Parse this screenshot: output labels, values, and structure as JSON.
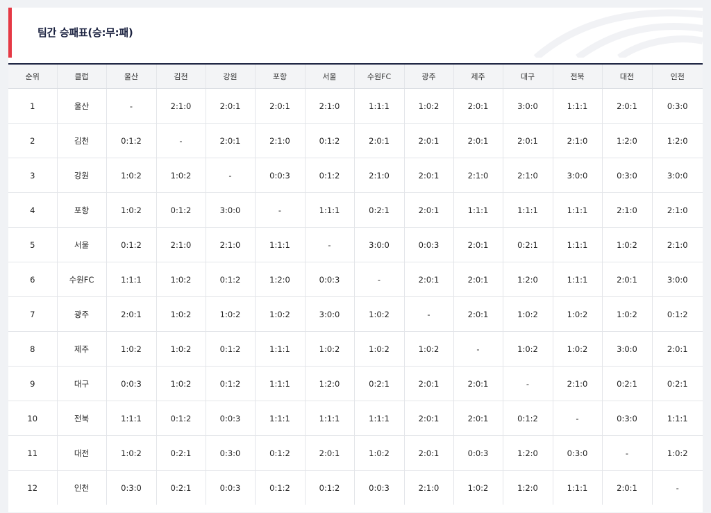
{
  "header": {
    "title": "팀간 승패표(승:무:패)"
  },
  "colors": {
    "accent": "#e53945",
    "navy": "#1b2240"
  },
  "table": {
    "columns": [
      "순위",
      "클럽",
      "울산",
      "김천",
      "강원",
      "포항",
      "서울",
      "수원FC",
      "광주",
      "제주",
      "대구",
      "전북",
      "대전",
      "인천"
    ],
    "rows": [
      [
        "1",
        "울산",
        "-",
        "2:1:0",
        "2:0:1",
        "2:0:1",
        "2:1:0",
        "1:1:1",
        "1:0:2",
        "2:0:1",
        "3:0:0",
        "1:1:1",
        "2:0:1",
        "0:3:0"
      ],
      [
        "2",
        "김천",
        "0:1:2",
        "-",
        "2:0:1",
        "2:1:0",
        "0:1:2",
        "2:0:1",
        "2:0:1",
        "2:0:1",
        "2:0:1",
        "2:1:0",
        "1:2:0",
        "1:2:0"
      ],
      [
        "3",
        "강원",
        "1:0:2",
        "1:0:2",
        "-",
        "0:0:3",
        "0:1:2",
        "2:1:0",
        "2:0:1",
        "2:1:0",
        "2:1:0",
        "3:0:0",
        "0:3:0",
        "3:0:0"
      ],
      [
        "4",
        "포항",
        "1:0:2",
        "0:1:2",
        "3:0:0",
        "-",
        "1:1:1",
        "0:2:1",
        "2:0:1",
        "1:1:1",
        "1:1:1",
        "1:1:1",
        "2:1:0",
        "2:1:0"
      ],
      [
        "5",
        "서울",
        "0:1:2",
        "2:1:0",
        "2:1:0",
        "1:1:1",
        "-",
        "3:0:0",
        "0:0:3",
        "2:0:1",
        "0:2:1",
        "1:1:1",
        "1:0:2",
        "2:1:0"
      ],
      [
        "6",
        "수원FC",
        "1:1:1",
        "1:0:2",
        "0:1:2",
        "1:2:0",
        "0:0:3",
        "-",
        "2:0:1",
        "2:0:1",
        "1:2:0",
        "1:1:1",
        "2:0:1",
        "3:0:0"
      ],
      [
        "7",
        "광주",
        "2:0:1",
        "1:0:2",
        "1:0:2",
        "1:0:2",
        "3:0:0",
        "1:0:2",
        "-",
        "2:0:1",
        "1:0:2",
        "1:0:2",
        "1:0:2",
        "0:1:2"
      ],
      [
        "8",
        "제주",
        "1:0:2",
        "1:0:2",
        "0:1:2",
        "1:1:1",
        "1:0:2",
        "1:0:2",
        "1:0:2",
        "-",
        "1:0:2",
        "1:0:2",
        "3:0:0",
        "2:0:1"
      ],
      [
        "9",
        "대구",
        "0:0:3",
        "1:0:2",
        "0:1:2",
        "1:1:1",
        "1:2:0",
        "0:2:1",
        "2:0:1",
        "2:0:1",
        "-",
        "2:1:0",
        "0:2:1",
        "0:2:1"
      ],
      [
        "10",
        "전북",
        "1:1:1",
        "0:1:2",
        "0:0:3",
        "1:1:1",
        "1:1:1",
        "1:1:1",
        "2:0:1",
        "2:0:1",
        "0:1:2",
        "-",
        "0:3:0",
        "1:1:1"
      ],
      [
        "11",
        "대전",
        "1:0:2",
        "0:2:1",
        "0:3:0",
        "0:1:2",
        "2:0:1",
        "1:0:2",
        "2:0:1",
        "0:0:3",
        "1:2:0",
        "0:3:0",
        "-",
        "1:0:2"
      ],
      [
        "12",
        "인천",
        "0:3:0",
        "0:2:1",
        "0:0:3",
        "0:1:2",
        "0:1:2",
        "0:0:3",
        "2:1:0",
        "1:0:2",
        "1:2:0",
        "1:1:1",
        "2:0:1",
        "-"
      ]
    ]
  }
}
